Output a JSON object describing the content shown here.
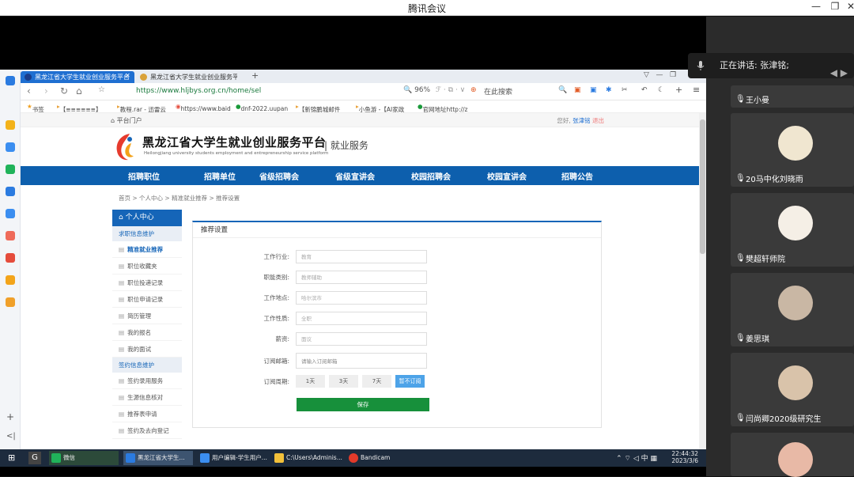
{
  "window": {
    "title": "腾讯会议"
  },
  "meeting": {
    "speaking": "正在讲话: 张津铭;",
    "participants": [
      {
        "name": "王小曼",
        "color": "#7a7a7a"
      },
      {
        "name": "20马中化刘晓雨",
        "color": "#f0e6d0"
      },
      {
        "name": "樊超轩师院",
        "color": "#f5efe6"
      },
      {
        "name": "姜思琪",
        "color": "#c9b7a4"
      },
      {
        "name": "闫尚卿2020级研究生",
        "color": "#d9c3aa"
      }
    ]
  },
  "browser": {
    "tabs": [
      "黑龙江省大学生就业创业服务平台",
      "黑龙江省大学生就业创业服务平台"
    ],
    "url": "https://www.hljbys.org.cn/home/sel",
    "zoom": "96%",
    "search_placeholder": "在此搜索",
    "bookmarks": [
      "书签",
      "【≡≡≡≡≡≡】",
      "教程.rar - 迅雷云",
      "https://www.baid",
      "dnf-2022.uupan",
      "【新锦鹏城邮件",
      "小鱼游 -【AI家政",
      "官网地址http://z"
    ]
  },
  "site": {
    "portal": "平台门户",
    "greeting": "您好,",
    "username": "张津铭",
    "logout": "退出",
    "name": "黑龙江省大学生就业创业服务平台",
    "name_en": "Heilongjiang university students employment and entrepreneurship service platform",
    "service": "就业服务",
    "nav": [
      "招聘职位",
      "招聘单位",
      "省级招聘会",
      "省级宣讲会",
      "校园招聘会",
      "校园宣讲会",
      "招聘公告"
    ],
    "breadcrumb": "首页 > 个人中心 > 精准就业推荐 > 推荐设置"
  },
  "menu": {
    "header": "个人中心",
    "section1": "求职信息维护",
    "items1": [
      "精准就业推荐",
      "职位收藏夹",
      "职位投递记录",
      "职位申请记录",
      "简历管理",
      "我的报名",
      "我的面试"
    ],
    "section2": "签约信息维护",
    "items2": [
      "签约录用服务",
      "生源信息核对",
      "推荐表申请",
      "签约及去向登记"
    ]
  },
  "form": {
    "title": "推荐设置",
    "fields": [
      {
        "label": "工作行业:",
        "value": "教育"
      },
      {
        "label": "职能类别:",
        "value": "教师辅助"
      },
      {
        "label": "工作地点:",
        "value": "哈尔滨市"
      },
      {
        "label": "工作性质:",
        "value": "全职"
      },
      {
        "label": "薪资:",
        "value": "面议"
      },
      {
        "label": "订阅邮箱:",
        "value": "请输入订阅邮箱"
      }
    ],
    "cycle_label": "订阅周期:",
    "cycles": [
      "1天",
      "3天",
      "7天",
      "暂不订阅"
    ],
    "save": "保存"
  },
  "taskbar": {
    "items": [
      "微信",
      "黑龙江省大学生...",
      "用户编辑-学生用户...",
      "C:\\Users\\Adminis...",
      "Bandicam"
    ],
    "tray": "中",
    "time": "22:44:32",
    "date": "2023/3/6"
  }
}
